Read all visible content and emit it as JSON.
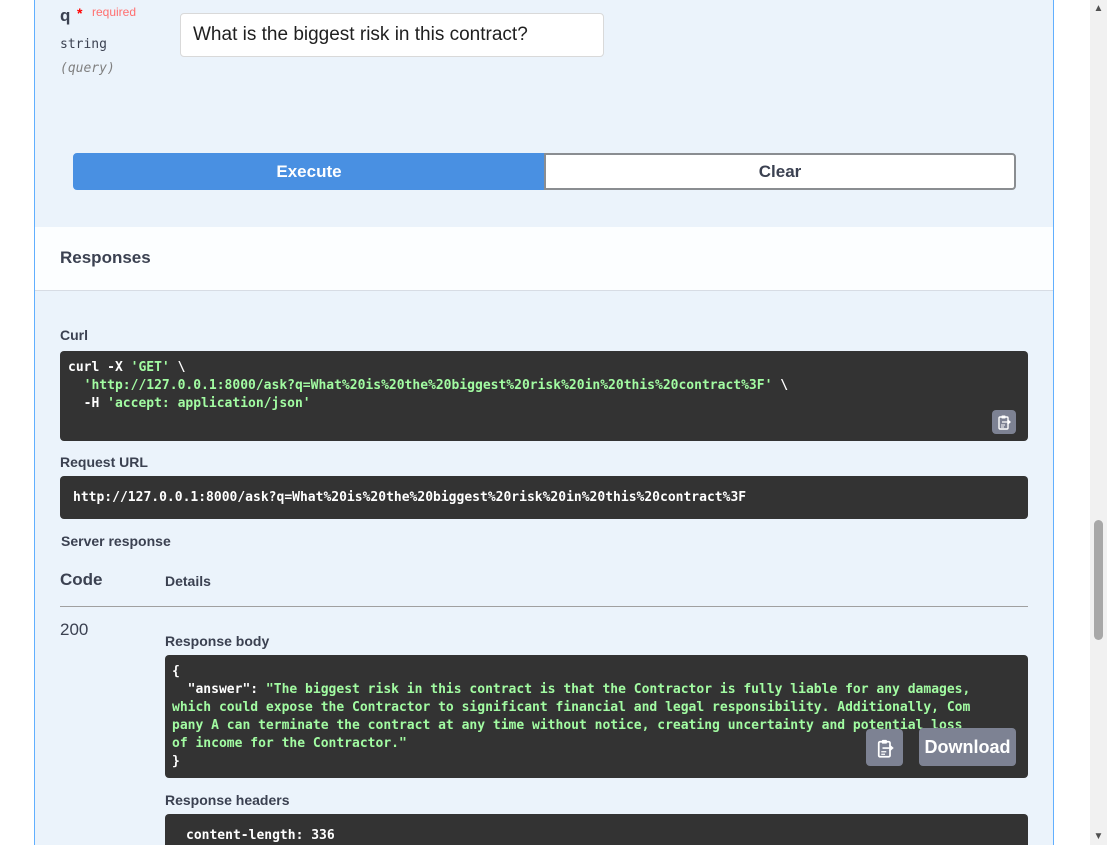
{
  "parameter": {
    "name": "q",
    "required_star": "*",
    "required_label": "required",
    "type": "string",
    "in": "(query)",
    "value": "What is the biggest risk in this contract?"
  },
  "actions": {
    "execute_label": "Execute",
    "clear_label": "Clear"
  },
  "responses": {
    "title": "Responses",
    "curl_label": "Curl",
    "curl": {
      "line1_cmd": "curl -X ",
      "line1_method": "'GET'",
      "line1_end": " \\",
      "line2_indent": "  ",
      "line2_url": "'http://127.0.0.1:8000/ask?q=What%20is%20the%20biggest%20risk%20in%20this%20contract%3F'",
      "line2_end": " \\",
      "line3_flag": "  -H ",
      "line3_header": "'accept: application/json'"
    },
    "request_url_label": "Request URL",
    "request_url": "http://127.0.0.1:8000/ask?q=What%20is%20the%20biggest%20risk%20in%20this%20contract%3F",
    "server_response_label": "Server response",
    "table": {
      "code_header": "Code",
      "details_header": "Details"
    },
    "status_code": "200",
    "body_label": "Response body",
    "body": {
      "open": "{",
      "key": "  \"answer\": ",
      "line1": "\"The biggest risk in this contract is that the Contractor is fully liable for any damages,",
      "line2": "which could expose the Contractor to significant financial and legal responsibility. Additionally, Com",
      "line3": "pany A can terminate the contract at any time without notice, creating uncertainty and potential loss",
      "line4": "of income for the Contractor.\"",
      "close": "}"
    },
    "download_label": "Download",
    "headers_label": "Response headers",
    "headers_line": "content-length: 336"
  },
  "icons": {
    "copy": "clipboard-copy-icon",
    "scroll_up": "▲",
    "scroll_down": "▼"
  }
}
